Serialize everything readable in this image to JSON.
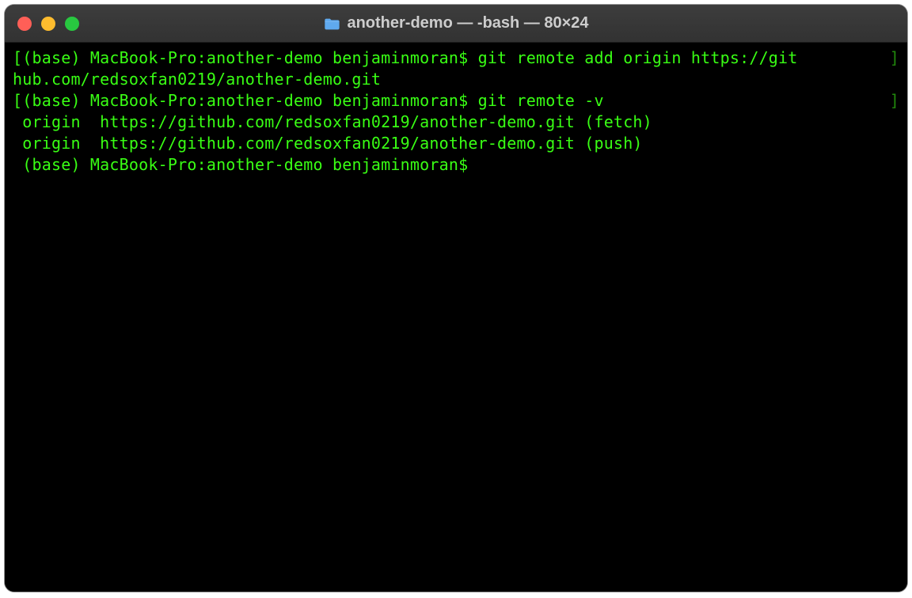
{
  "window": {
    "title": "another-demo — -bash — 80×24"
  },
  "terminal": {
    "bracket_open": "[",
    "bracket_close": "]",
    "line1_cmd": "(base) MacBook-Pro:another-demo benjaminmoran$ git remote add origin https://git",
    "line1_wrap": "hub.com/redsoxfan0219/another-demo.git",
    "line2_cmd": "(base) MacBook-Pro:another-demo benjaminmoran$ git remote -v",
    "line3": " origin  https://github.com/redsoxfan0219/another-demo.git (fetch)",
    "line4": " origin  https://github.com/redsoxfan0219/another-demo.git (push)",
    "line5": " (base) MacBook-Pro:another-demo benjaminmoran$ "
  }
}
